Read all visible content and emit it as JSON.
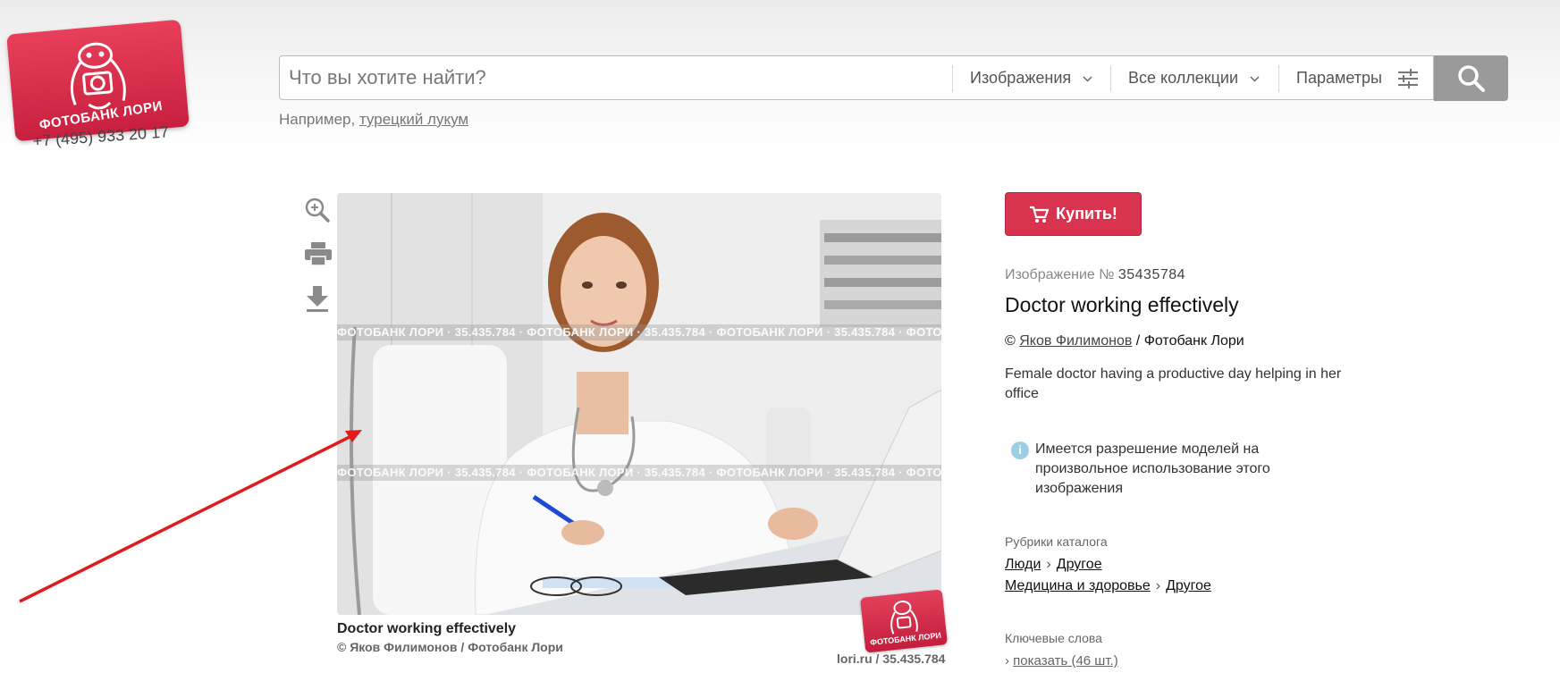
{
  "header": {
    "logo_text": "ФОТОБАНК ЛОРИ",
    "phone": "+7 (495) 933 20 17"
  },
  "search": {
    "placeholder": "Что вы хотите найти?",
    "type_label": "Изображения",
    "collection_label": "Все коллекции",
    "params_label": "Параметры",
    "example_prefix": "Например,",
    "example_link": "турецкий лукум"
  },
  "tools": {
    "zoom_icon": "zoom-in-icon",
    "print_icon": "printer-icon",
    "download_icon": "download-icon"
  },
  "photo": {
    "watermark_text": "ФОТОБАНК ЛОРИ · 35.435.784 · ФОТОБАНК ЛОРИ · 35.435.784 · ФОТОБАНК ЛОРИ · 35.435.784 · ФОТОБАНК ЛОРИ · 35.435.784 · ФОТОБАНК ЛОРИ · 35.435.784",
    "stamp_text": "ФОТОБАНК ЛОРИ",
    "caption_title": "Doctor working effectively",
    "caption_author": "© Яков Филимонов / Фотобанк Лори",
    "caption_ref": "lori.ru / 35.435.784"
  },
  "details": {
    "buy_label": "Купить!",
    "image_number_label": "Изображение №",
    "image_number": "35435784",
    "title": "Doctor working effectively",
    "copyright": "©",
    "author": "Яков Филимонов",
    "credit_sep": "/",
    "agency": "Фотобанк Лори",
    "description": "Female doctor having a productive day helping in her office",
    "release_note": "Имеется разрешение моделей на произвольное использование этого изображения",
    "categories_label": "Рубрики каталога",
    "categories": [
      {
        "parent": "Люди",
        "child": "Другое"
      },
      {
        "parent": "Медицина и здоровье",
        "child": "Другое"
      }
    ],
    "keywords_label": "Ключевые слова",
    "keywords_link": "показать (46 шт.)"
  },
  "colors": {
    "brand": "#d8344f",
    "search_button": "#9a9a9a",
    "annotation_arrow": "#e01b1b"
  }
}
